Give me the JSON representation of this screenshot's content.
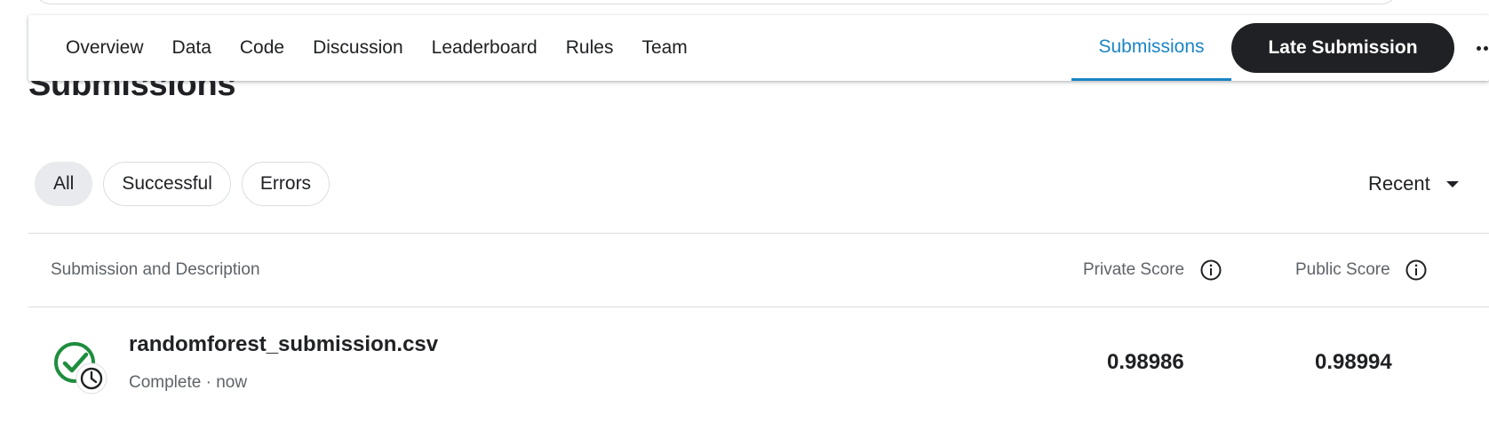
{
  "nav": {
    "tabs": [
      {
        "label": "Overview"
      },
      {
        "label": "Data"
      },
      {
        "label": "Code"
      },
      {
        "label": "Discussion"
      },
      {
        "label": "Leaderboard"
      },
      {
        "label": "Rules"
      },
      {
        "label": "Team"
      }
    ],
    "active_tab": "Submissions",
    "late_submission_label": "Late Submission",
    "more_icon": "more-horizontal-icon"
  },
  "page": {
    "title": "Submissions"
  },
  "filters": {
    "chips": [
      {
        "label": "All",
        "selected": true
      },
      {
        "label": "Successful",
        "selected": false
      },
      {
        "label": "Errors",
        "selected": false
      }
    ],
    "sort_label": "Recent"
  },
  "table": {
    "headers": {
      "description": "Submission and Description",
      "private_score": "Private Score",
      "public_score": "Public Score"
    },
    "rows": [
      {
        "file_name": "randomforest_submission.csv",
        "meta": "Complete · now",
        "private_score": "0.98986",
        "public_score": "0.98994",
        "status_icon": "check-circle-clock-icon"
      }
    ]
  },
  "colors": {
    "accent_blue": "#1a85c4",
    "success_green": "#1e8e3e",
    "dark": "#202124"
  }
}
